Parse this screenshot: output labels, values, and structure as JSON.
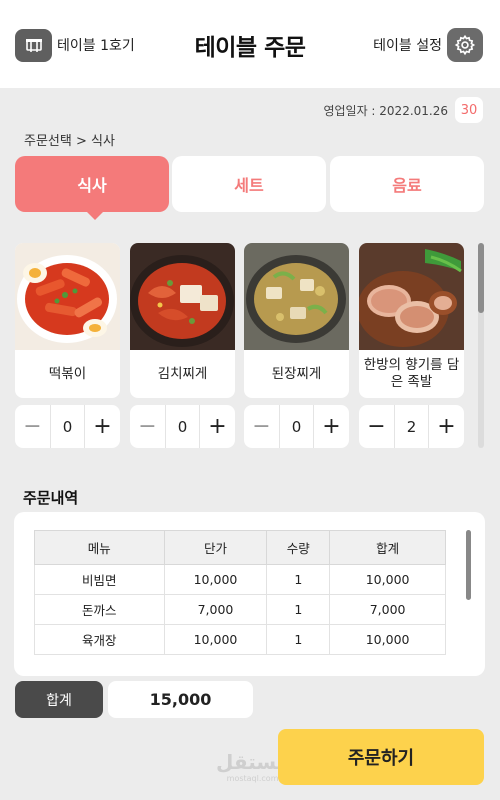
{
  "header": {
    "table_name": "테이블 1호기",
    "title": "테이블 주문",
    "settings_label": "테이블 설정"
  },
  "business": {
    "date_text": "영업일자 : 2022.01.26",
    "count": "30"
  },
  "breadcrumb": "주문선택 > 식사",
  "tabs": [
    {
      "label": "식사",
      "active": true
    },
    {
      "label": "세트",
      "active": false
    },
    {
      "label": "음료",
      "active": false
    }
  ],
  "menu_items": [
    {
      "name": "떡볶이",
      "quantity": "0",
      "image": "tteokbokki-photo"
    },
    {
      "name": "김치찌게",
      "quantity": "0",
      "image": "kimchi-stew-photo"
    },
    {
      "name": "된장찌게",
      "quantity": "0",
      "image": "doenjang-stew-photo"
    },
    {
      "name": "한방의 향기를 담은 족발",
      "quantity": "2",
      "image": "jokbal-photo"
    }
  ],
  "order_section_title": "주문내역",
  "order_table": {
    "headers": [
      "메뉴",
      "단가",
      "수량",
      "합계"
    ],
    "rows": [
      [
        "비빔면",
        "10,000",
        "1",
        "10,000"
      ],
      [
        "돈까스",
        "7,000",
        "1",
        "7,000"
      ],
      [
        "육개장",
        "10,000",
        "1",
        "10,000"
      ]
    ]
  },
  "total": {
    "label": "합계",
    "value": "15,000"
  },
  "order_button": "주문하기",
  "watermark": {
    "main": "مستقل",
    "sub": "mostaql.com"
  },
  "colors": {
    "accent": "#f47a7a",
    "order_button": "#fdd24c",
    "dark": "#4a4a4a",
    "background": "#ececec"
  },
  "icons": {
    "table": "table-icon",
    "settings": "gear-icon",
    "minus": "minus-icon",
    "plus": "plus-icon"
  }
}
